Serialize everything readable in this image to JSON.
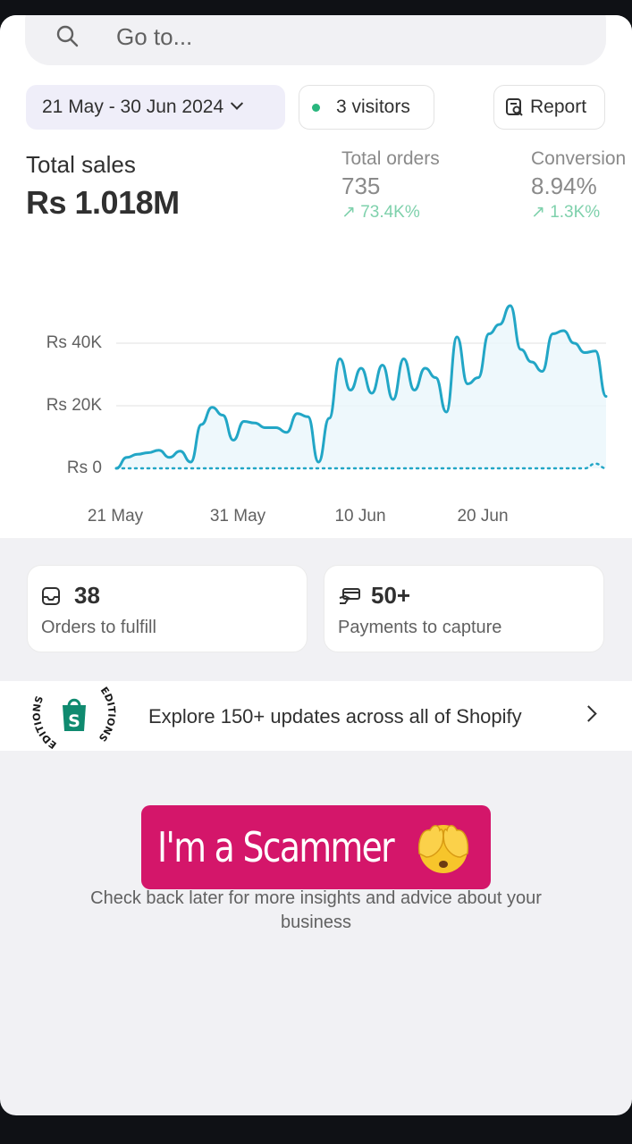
{
  "search": {
    "placeholder": "Go to...",
    "icon": "search-icon"
  },
  "filters": {
    "date_range": "21 May - 30 Jun 2024",
    "visitors": "3 visitors",
    "report": "Report",
    "visitor_dot_color": "#29b67e"
  },
  "metrics": {
    "total_sales": {
      "label": "Total sales",
      "value": "Rs 1.018M"
    },
    "total_orders": {
      "label": "Total orders",
      "value": "735",
      "trend": "↗ 73.4K%"
    },
    "conversion": {
      "label": "Conversion",
      "value": "8.94%",
      "trend": "↗ 1.3K%"
    }
  },
  "chart_data": {
    "type": "line",
    "x_ticks": [
      "21 May",
      "31 May",
      "10 Jun",
      "20 Jun"
    ],
    "y_ticks": [
      "Rs 0",
      "Rs 20K",
      "Rs 40K"
    ],
    "ylim": [
      0,
      50000
    ],
    "grid": true,
    "series": [
      {
        "color": "#22a6c6",
        "style": "solid",
        "values": [
          0,
          3500,
          4500,
          5000,
          5800,
          3500,
          5500,
          2000,
          14000,
          19500,
          17000,
          9000,
          15000,
          14500,
          13000,
          13000,
          11500,
          17500,
          16500,
          2000,
          16000,
          35000,
          25000,
          32000,
          24000,
          33000,
          22000,
          35000,
          25000,
          32000,
          29000,
          18000,
          42000,
          27000,
          29000,
          43000,
          46000,
          52000,
          38000,
          34000,
          31000,
          43000,
          44000,
          40000,
          37000,
          37500,
          23000
        ]
      },
      {
        "color": "#22a6c6",
        "style": "dotted",
        "values": [
          0,
          0,
          0,
          0,
          0,
          0,
          0,
          0,
          0,
          0,
          0,
          0,
          0,
          0,
          0,
          0,
          0,
          0,
          0,
          0,
          0,
          0,
          0,
          0,
          0,
          0,
          0,
          0,
          0,
          0,
          0,
          0,
          0,
          0,
          0,
          0,
          0,
          0,
          0,
          0,
          0,
          0,
          0,
          0,
          0,
          1500,
          0
        ]
      }
    ]
  },
  "tasks": [
    {
      "count": "38",
      "label": "Orders to fulfill",
      "icon": "inbox-icon"
    },
    {
      "count": "50+",
      "label": "Payments to capture",
      "icon": "payment-icon"
    }
  ],
  "editions": {
    "text": "Explore 150+ updates across all of Shopify",
    "badge_text": "EDITIONS",
    "badge_letter": "S"
  },
  "empty_state": {
    "line1": "Check back later for more insights and advice about your",
    "line2": "business"
  },
  "sticker": {
    "text": "I'm a Scammer",
    "icon": "face-covering-eyes-emoji",
    "color": "#d4166a"
  }
}
